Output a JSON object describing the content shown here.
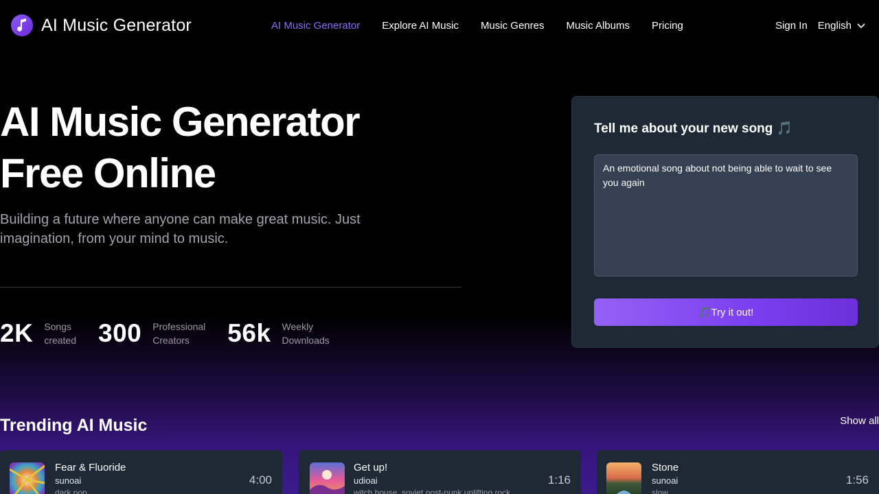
{
  "header": {
    "brand_name": "AI Music Generator",
    "nav": [
      {
        "label": "AI Music Generator",
        "active": true
      },
      {
        "label": "Explore AI Music",
        "active": false
      },
      {
        "label": "Music Genres",
        "active": false
      },
      {
        "label": "Music Albums",
        "active": false
      },
      {
        "label": "Pricing",
        "active": false
      }
    ],
    "sign_in": "Sign In",
    "language": "English"
  },
  "hero": {
    "title_line1": "AI Music Generator",
    "title_line2": "Free Online",
    "subtitle": "Building a future where anyone can make great music. Just imagination, from your mind to music.",
    "stats": [
      {
        "value": "2K",
        "label": "Songs\ncreated"
      },
      {
        "value": "300",
        "label": "Professional\nCreators"
      },
      {
        "value": "56k",
        "label": "Weekly\nDownloads"
      }
    ]
  },
  "generator": {
    "title": "Tell me about your new song 🎵",
    "prompt_value": "An emotional song about not being able to wait to see you again",
    "button_label": "🎵Try it out!"
  },
  "trending": {
    "title": "Trending AI Music",
    "show_all": "Show all",
    "tracks": [
      {
        "title": "Fear & Fluoride",
        "artist": "sunoai",
        "tags": "dark pop",
        "duration": "4:00"
      },
      {
        "title": "Get up!",
        "artist": "udioai",
        "tags": "witch house, soviet post-punk uplifting rock",
        "duration": "1:16"
      },
      {
        "title": "Stone",
        "artist": "sunoai",
        "tags": "slow",
        "duration": "1:56"
      }
    ]
  },
  "colors": {
    "accent": "#8b6cf6",
    "card_bg": "#1e2935",
    "button_gradient_start": "#9461f5",
    "button_gradient_end": "#6d2fd8"
  },
  "icons": {
    "logo": "music-note-icon",
    "language_caret": "chevron-down-icon"
  }
}
